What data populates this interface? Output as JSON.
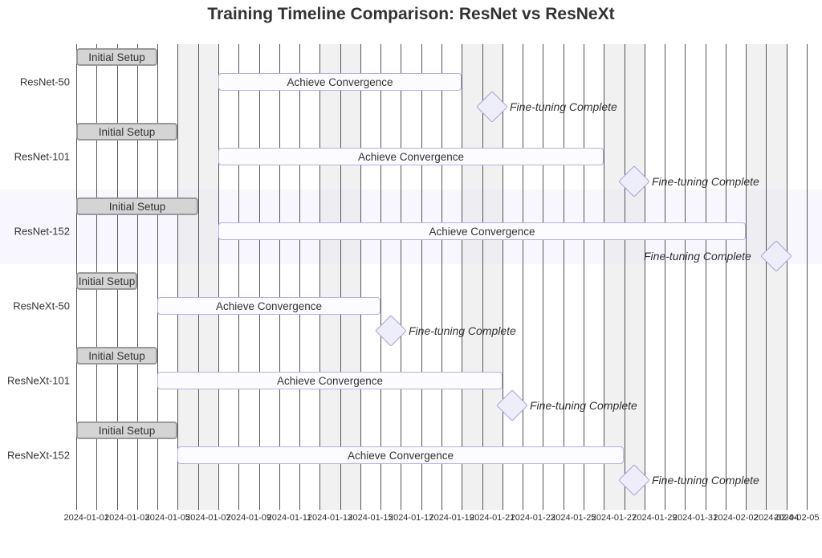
{
  "chart_data": {
    "type": "gantt",
    "title": "Training Timeline Comparison: ResNet vs ResNeXt",
    "x_axis": {
      "start": "2024-01-01",
      "end": "2024-02-06",
      "ticks": [
        "2024-01-01",
        "2024-01-03",
        "2024-01-05",
        "2024-01-07",
        "2024-01-09",
        "2024-01-11",
        "2024-01-13",
        "2024-01-15",
        "2024-01-17",
        "2024-01-19",
        "2024-01-21",
        "2024-01-23",
        "2024-01-25",
        "2024-01-27",
        "2024-01-29",
        "2024-01-31",
        "2024-02-02",
        "2024-02-04",
        "2024-02-05"
      ]
    },
    "sections": [
      "ResNet-50",
      "ResNet-101",
      "ResNet-152",
      "ResNeXt-50",
      "ResNeXt-101",
      "ResNeXt-152"
    ],
    "labels": {
      "initial_setup": "Initial Setup",
      "achieve_convergence": "Achieve Convergence",
      "fine_tuning_complete": "Fine-tuning Complete"
    },
    "tasks": [
      {
        "section": "ResNet-50",
        "name": "Initial Setup",
        "start": "2024-01-01",
        "end": "2024-01-05",
        "status": "done"
      },
      {
        "section": "ResNet-50",
        "name": "Achieve Convergence",
        "start": "2024-01-08",
        "end": "2024-01-19",
        "status": "active"
      },
      {
        "section": "ResNet-50",
        "name": "Fine-tuning Complete",
        "milestone": true,
        "date": "2024-01-21"
      },
      {
        "section": "ResNet-101",
        "name": "Initial Setup",
        "start": "2024-01-01",
        "end": "2024-01-06",
        "status": "done"
      },
      {
        "section": "ResNet-101",
        "name": "Achieve Convergence",
        "start": "2024-01-08",
        "end": "2024-01-26",
        "status": "active"
      },
      {
        "section": "ResNet-101",
        "name": "Fine-tuning Complete",
        "milestone": true,
        "date": "2024-01-28"
      },
      {
        "section": "ResNet-152",
        "name": "Initial Setup",
        "start": "2024-01-01",
        "end": "2024-01-07",
        "status": "done"
      },
      {
        "section": "ResNet-152",
        "name": "Achieve Convergence",
        "start": "2024-01-08",
        "end": "2024-02-02",
        "status": "active"
      },
      {
        "section": "ResNet-152",
        "name": "Fine-tuning Complete",
        "milestone": true,
        "date": "2024-02-04"
      },
      {
        "section": "ResNeXt-50",
        "name": "Initial Setup",
        "start": "2024-01-01",
        "end": "2024-01-04",
        "status": "done"
      },
      {
        "section": "ResNeXt-50",
        "name": "Achieve Convergence",
        "start": "2024-01-05",
        "end": "2024-01-15",
        "status": "active"
      },
      {
        "section": "ResNeXt-50",
        "name": "Fine-tuning Complete",
        "milestone": true,
        "date": "2024-01-16"
      },
      {
        "section": "ResNeXt-101",
        "name": "Initial Setup",
        "start": "2024-01-01",
        "end": "2024-01-05",
        "status": "done"
      },
      {
        "section": "ResNeXt-101",
        "name": "Achieve Convergence",
        "start": "2024-01-05",
        "end": "2024-01-21",
        "status": "active"
      },
      {
        "section": "ResNeXt-101",
        "name": "Fine-tuning Complete",
        "milestone": true,
        "date": "2024-01-22"
      },
      {
        "section": "ResNeXt-152",
        "name": "Initial Setup",
        "start": "2024-01-01",
        "end": "2024-01-06",
        "status": "done"
      },
      {
        "section": "ResNeXt-152",
        "name": "Achieve Convergence",
        "start": "2024-01-06",
        "end": "2024-01-27",
        "status": "active"
      },
      {
        "section": "ResNeXt-152",
        "name": "Fine-tuning Complete",
        "milestone": true,
        "date": "2024-01-28"
      }
    ]
  }
}
